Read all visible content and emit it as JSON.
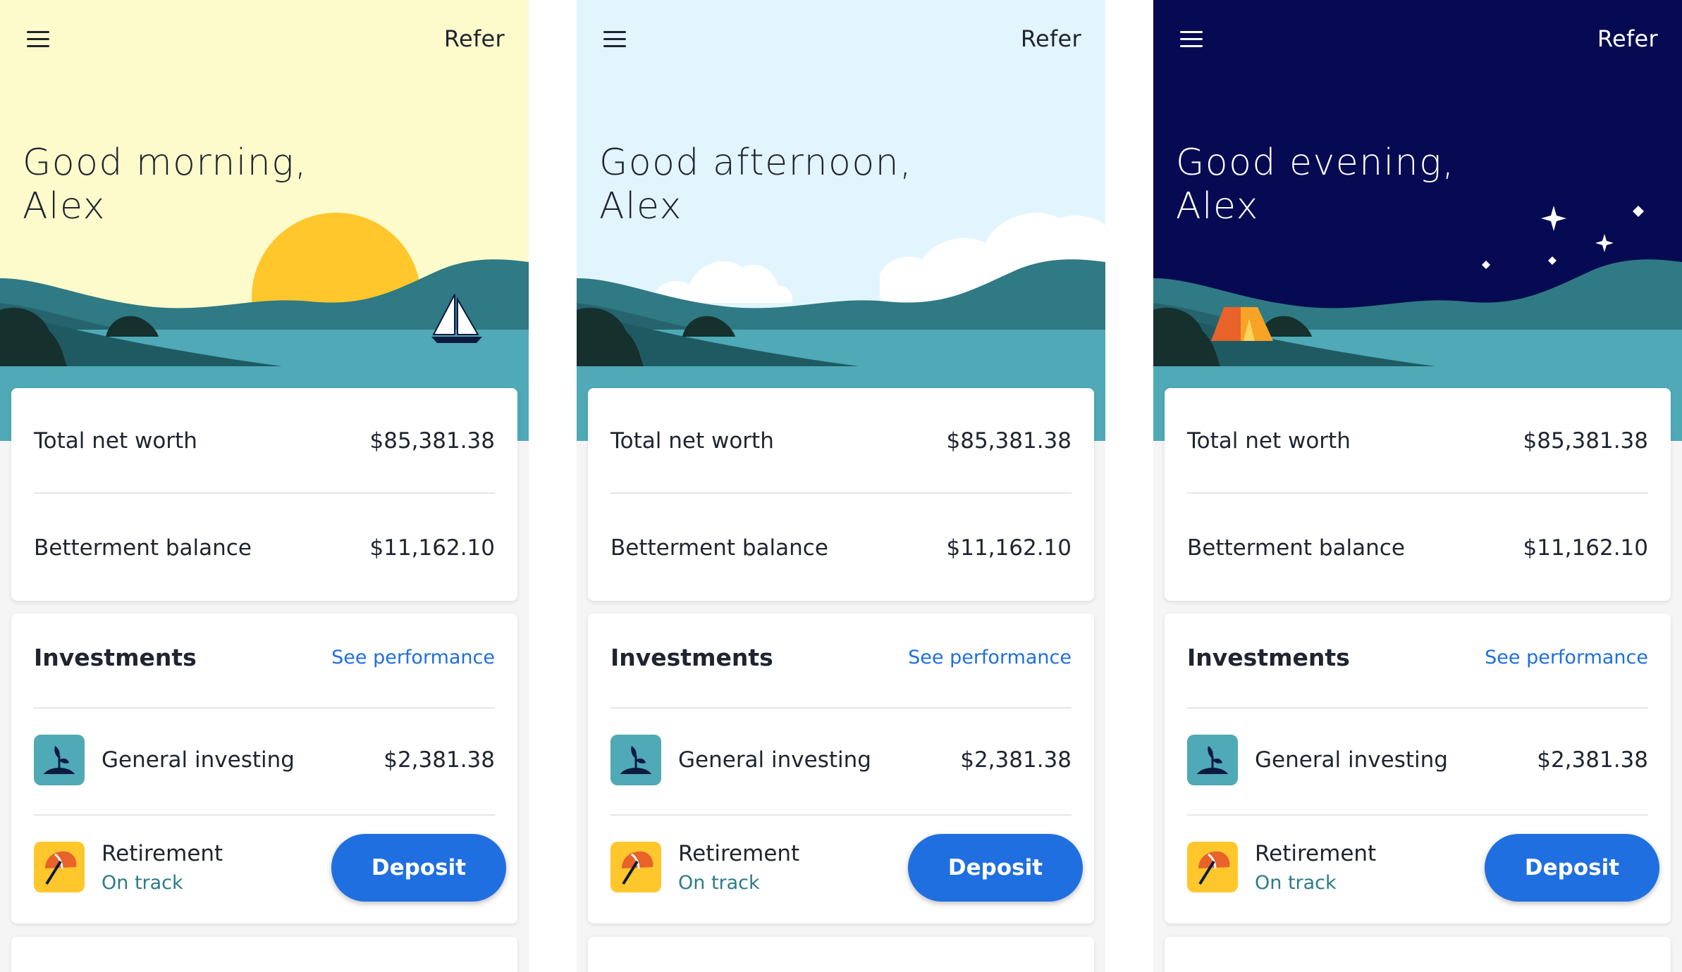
{
  "screens": [
    {
      "refer_label": "Refer",
      "greeting_line1": "Good morning,",
      "greeting_line2": "Alex",
      "sky_color": "#fdfbcb",
      "text_color": "#1f2430",
      "scene_icon": "sun-and-sailboat"
    },
    {
      "refer_label": "Refer",
      "greeting_line1": "Good afternoon,",
      "greeting_line2": "Alex",
      "sky_color": "#e2f5fd",
      "text_color": "#1f2430",
      "scene_icon": "clouds"
    },
    {
      "refer_label": "Refer",
      "greeting_line1": "Good evening,",
      "greeting_line2": "Alex",
      "sky_color": "#050a52",
      "text_color": "#ffffff",
      "scene_icon": "stars-and-tent"
    }
  ],
  "summary": {
    "net_worth_label": "Total net worth",
    "net_worth_value": "$85,381.38",
    "balance_label": "Betterment balance",
    "balance_value": "$11,162.10"
  },
  "investments": {
    "title": "Investments",
    "see_performance": "See performance",
    "general": {
      "icon": "sprout-icon",
      "name": "General investing",
      "value": "$2,381.38"
    },
    "retirement": {
      "icon": "umbrella-icon",
      "name": "Retirement",
      "status": "On track"
    }
  },
  "deposit_label": "Deposit",
  "colors": {
    "accent": "#1f6fe0",
    "water": "#4fa9b6",
    "status_green": "#2b7c8a",
    "sun": "#ffc72c",
    "tent": "#e8622a"
  }
}
